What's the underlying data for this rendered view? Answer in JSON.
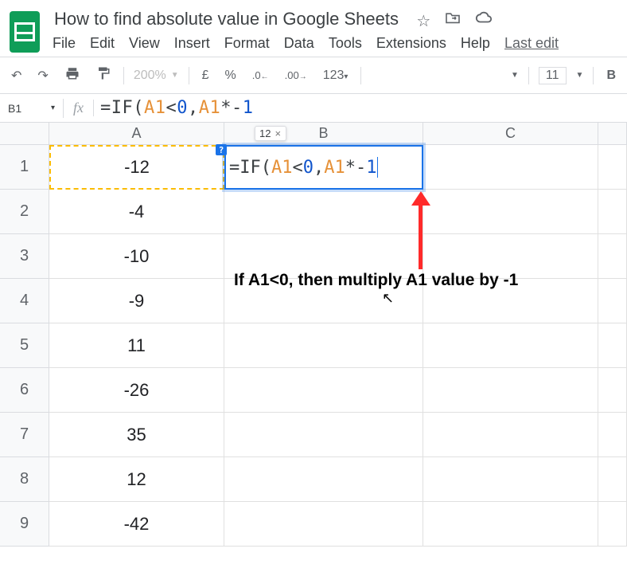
{
  "header": {
    "doc_title": "How to find absolute value in Google Sheets",
    "menu": {
      "file": "File",
      "edit": "Edit",
      "view": "View",
      "insert": "Insert",
      "format": "Format",
      "data": "Data",
      "tools": "Tools",
      "extensions": "Extensions",
      "help": "Help",
      "last_edit": "Last edit"
    }
  },
  "toolbar": {
    "zoom": "200%",
    "currency": "£",
    "percent": "%",
    "dec_dec": ".0",
    "inc_dec": ".00",
    "more_formats": "123",
    "font_size": "11"
  },
  "formula_bar": {
    "cell_ref": "B1",
    "fx_label": "fx",
    "parts": {
      "eq": "=IF",
      "lp": "(",
      "r1": "A1",
      "op1": "<",
      "n1": "0",
      "cm": ",",
      "r2": "A1",
      "op2": "*-",
      "n2": "1"
    }
  },
  "hint": {
    "value": "12"
  },
  "columns": {
    "A": "A",
    "B": "B",
    "C": "C"
  },
  "rows": {
    "1": {
      "num": "1",
      "A": "-12"
    },
    "2": {
      "num": "2",
      "A": "-4"
    },
    "3": {
      "num": "3",
      "A": "-10"
    },
    "4": {
      "num": "4",
      "A": "-9"
    },
    "5": {
      "num": "5",
      "A": "11"
    },
    "6": {
      "num": "6",
      "A": "-26"
    },
    "7": {
      "num": "7",
      "A": "35"
    },
    "8": {
      "num": "8",
      "A": "12"
    },
    "9": {
      "num": "9",
      "A": "-42"
    }
  },
  "annotation": {
    "text": "If A1<0, then multiply A1 value by -1"
  }
}
